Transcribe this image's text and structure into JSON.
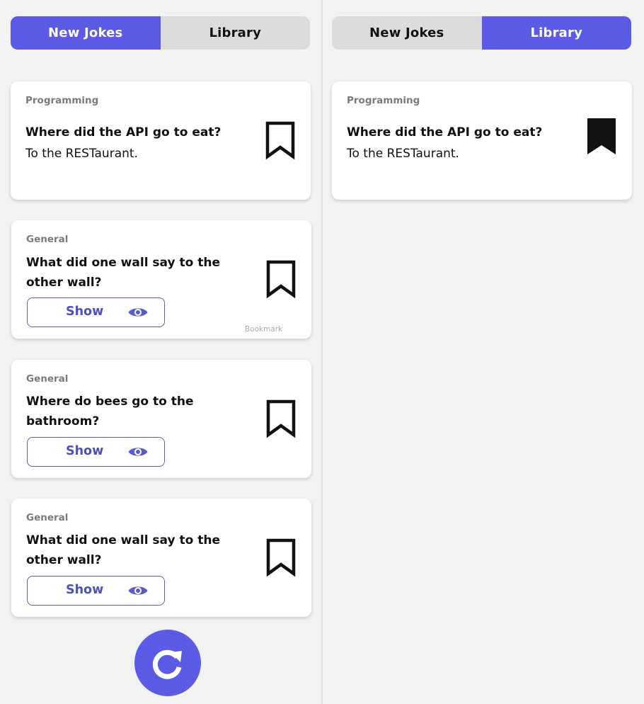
{
  "tabs": {
    "new_jokes": "New Jokes",
    "library": "Library"
  },
  "left": {
    "active_tab": "New Jokes",
    "jokes": [
      {
        "category": "Programming",
        "setup": "Where did the API go to eat?",
        "punchline": "To the RESTaurant.",
        "bookmarked": false
      },
      {
        "category": "General",
        "setup": "What did one wall say to the other wall?",
        "show_label": "Show",
        "bookmarked": false,
        "tooltip": "Bookmark"
      },
      {
        "category": "General",
        "setup": "Where do bees go to the bathroom?",
        "show_label": "Show",
        "bookmarked": false
      },
      {
        "category": "General",
        "setup": "What did one wall say to the other wall?",
        "show_label": "Show",
        "bookmarked": false
      }
    ],
    "refresh_icon": "refresh-icon"
  },
  "right": {
    "active_tab": "Library",
    "jokes": [
      {
        "category": "Programming",
        "setup": "Where did the API go to eat?",
        "punchline": "To the RESTaurant.",
        "bookmarked": true
      }
    ]
  },
  "colors": {
    "accent": "#5b5be6",
    "background": "#f2f2f2",
    "card": "#ffffff",
    "inactive_tab": "#dcdcdc"
  },
  "icons": {
    "bookmark": "bookmark-icon",
    "bookmark_filled": "bookmark-filled-icon",
    "eye": "eye-icon"
  }
}
